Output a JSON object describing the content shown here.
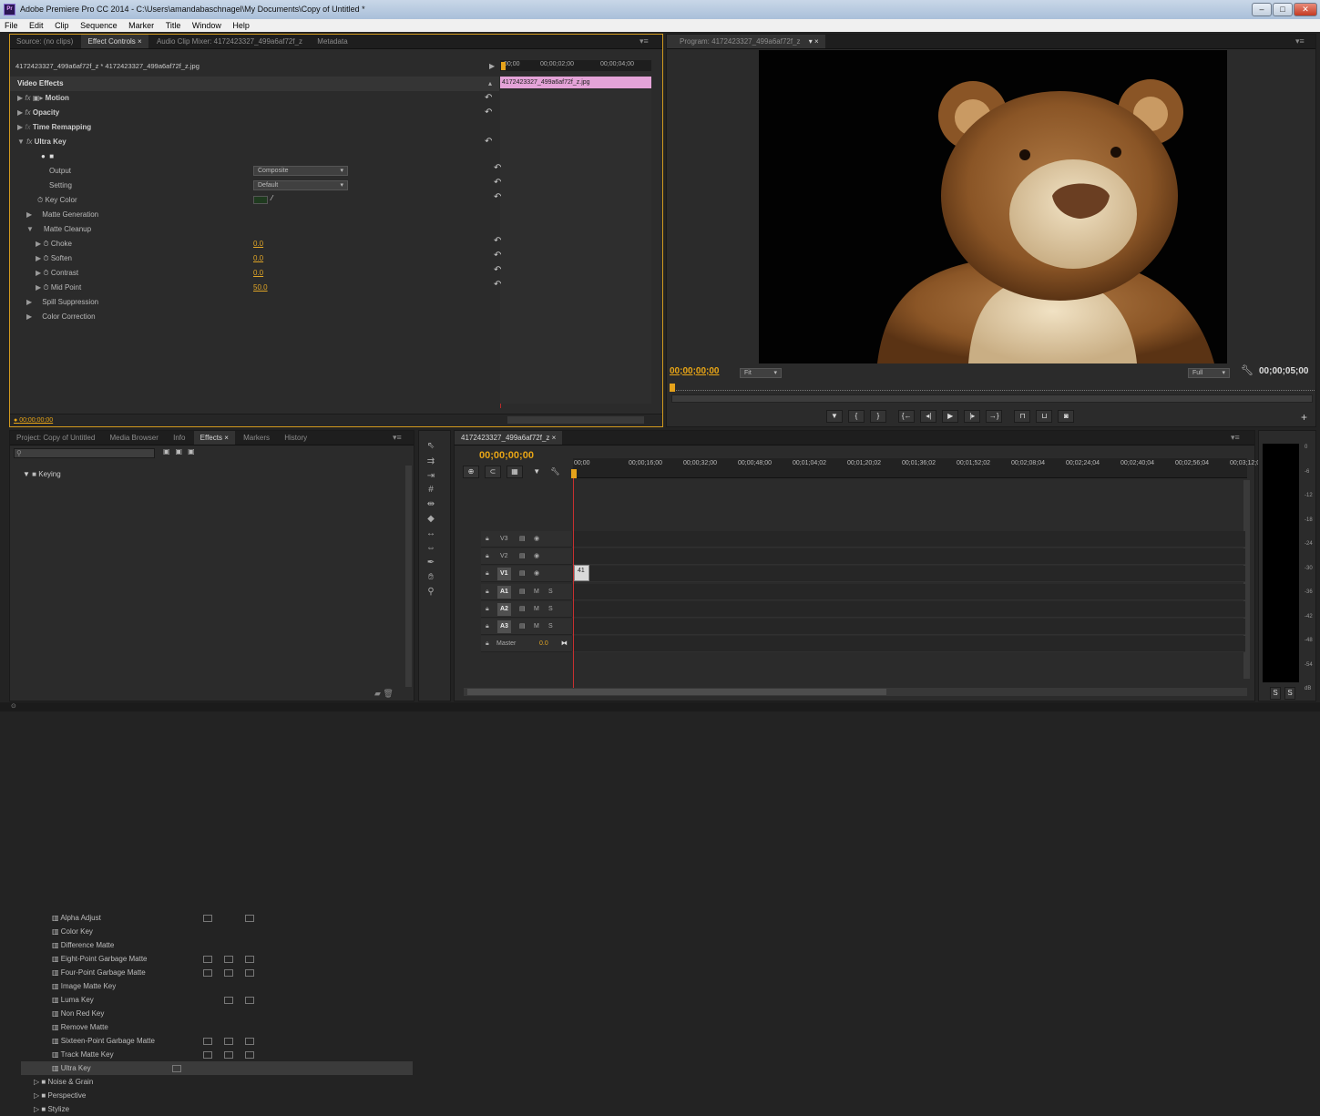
{
  "window": {
    "title": "Adobe Premiere Pro CC 2014 - C:\\Users\\amandabaschnagel\\My Documents\\Copy of Untitled *",
    "app_icon": "Pr"
  },
  "menu": [
    "File",
    "Edit",
    "Clip",
    "Sequence",
    "Marker",
    "Title",
    "Window",
    "Help"
  ],
  "source_panel": {
    "tabs": [
      "Source: (no clips)",
      "Effect Controls ×",
      "Audio Clip Mixer: 4172423327_499a6af72f_z",
      "Metadata"
    ],
    "clip_path": "4172423327_499a6af72f_z * 4172423327_499a6af72f_z.jpg",
    "ruler": [
      "00;00",
      "00;00;02;00",
      "00;00;04;00"
    ],
    "clip_bar_label": "4172423327_499a6af72f_z.jpg",
    "section": "Video Effects",
    "effects": [
      {
        "label": "Motion"
      },
      {
        "label": "Opacity"
      },
      {
        "label": "Time Remapping"
      },
      {
        "label": "Ultra Key"
      }
    ],
    "ultra_key": {
      "output_label": "Output",
      "output_value": "Composite",
      "setting_label": "Setting",
      "setting_value": "Default",
      "keycolor_label": "Key Color",
      "key_color": "#1f3a1f",
      "matte_generation": "Matte Generation",
      "matte_cleanup": "Matte Cleanup",
      "choke_label": "Choke",
      "choke": "0.0",
      "soften_label": "Soften",
      "soften": "0.0",
      "contrast_label": "Contrast",
      "contrast": "0.0",
      "midpoint_label": "Mid Point",
      "midpoint": "50.0",
      "spill": "Spill Suppression",
      "color_correction": "Color Correction"
    },
    "bottom_timecode": "00;00;00;00"
  },
  "program_panel": {
    "tab": "Program: 4172423327_499a6af72f_z",
    "timecode_current": "00;00;00;00",
    "fit": "Fit",
    "quality": "Full",
    "timecode_duration": "00;00;05;00"
  },
  "project_panel": {
    "tabs": [
      "Project: Copy of Untitled",
      "Media Browser",
      "Info",
      "Effects ×",
      "Markers",
      "History"
    ],
    "folder_keying": "Keying",
    "items": [
      "Alpha Adjust",
      "Color Key",
      "Difference Matte",
      "Eight-Point Garbage Matte",
      "Four-Point Garbage Matte",
      "Image Matte Key",
      "Luma Key",
      "Non Red Key",
      "Remove Matte",
      "Sixteen-Point Garbage Matte",
      "Track Matte Key",
      "Ultra Key"
    ],
    "folders_after": [
      "Noise & Grain",
      "Perspective",
      "Stylize"
    ]
  },
  "timeline": {
    "tab": "4172423327_499a6af72f_z ×",
    "timecode": "00;00;00;00",
    "ruler": [
      "00;00",
      "00;00;16;00",
      "00;00;32;00",
      "00;00;48;00",
      "00;01;04;02",
      "00;01;20;02",
      "00;01;36;02",
      "00;01;52;02",
      "00;02;08;04",
      "00;02;24;04",
      "00;02;40;04",
      "00;02;56;04",
      "00;03;12;0"
    ],
    "video_tracks": [
      "V3",
      "V2",
      "V1"
    ],
    "audio_tracks": [
      "A1",
      "A2",
      "A3"
    ],
    "master_label": "Master",
    "master_value": "0.0",
    "clip_label": "41"
  },
  "audio_meter": {
    "labels": [
      "0",
      "-6",
      "-12",
      "-18",
      "-24",
      "-30",
      "-36",
      "-42",
      "-48",
      "-54",
      "dB"
    ],
    "solo": [
      "S",
      "S"
    ]
  }
}
